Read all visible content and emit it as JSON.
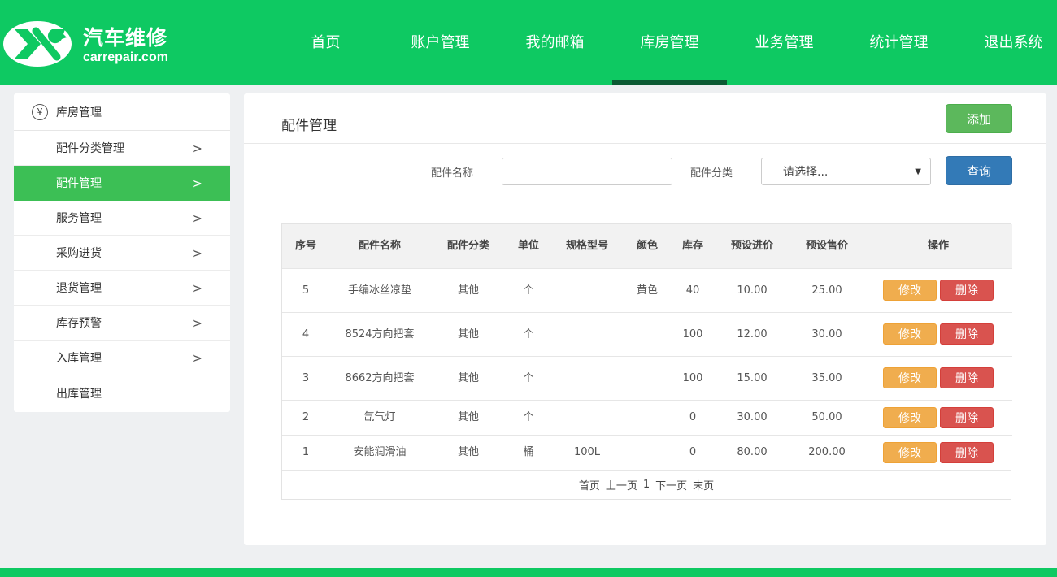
{
  "brand": {
    "title": "汽车维修",
    "subtitle": "carrepair.com"
  },
  "nav": [
    {
      "label": "首页",
      "active": false
    },
    {
      "label": "账户管理",
      "active": false
    },
    {
      "label": "我的邮箱",
      "active": false
    },
    {
      "label": "库房管理",
      "active": true
    },
    {
      "label": "业务管理",
      "active": false
    },
    {
      "label": "统计管理",
      "active": false
    },
    {
      "label": "退出系统",
      "active": false
    }
  ],
  "sidebar": {
    "header": "库房管理",
    "header_icon_glyph": "¥",
    "items": [
      {
        "label": "配件分类管理",
        "chevron": true,
        "active": false
      },
      {
        "label": "配件管理",
        "chevron": true,
        "active": true
      },
      {
        "label": "服务管理",
        "chevron": true,
        "active": false
      },
      {
        "label": "采购进货",
        "chevron": true,
        "active": false
      },
      {
        "label": "退货管理",
        "chevron": true,
        "active": false
      },
      {
        "label": "库存预警",
        "chevron": true,
        "active": false
      },
      {
        "label": "入库管理",
        "chevron": true,
        "active": false
      },
      {
        "label": "出库管理",
        "chevron": false,
        "active": false
      }
    ]
  },
  "panel": {
    "title": "配件管理",
    "add_label": "添加"
  },
  "search": {
    "name_label": "配件名称",
    "name_value": "",
    "category_label": "配件分类",
    "category_selected": "请选择...",
    "query_label": "查询"
  },
  "table": {
    "headers": [
      "序号",
      "配件名称",
      "配件分类",
      "单位",
      "规格型号",
      "颜色",
      "库存",
      "预设进价",
      "预设售价",
      "操作"
    ],
    "rows": [
      {
        "id": "5",
        "name": "手编冰丝凉垫",
        "category": "其他",
        "unit": "个",
        "spec": "",
        "color": "黄色",
        "stock": "40",
        "buy": "10.00",
        "sell": "25.00"
      },
      {
        "id": "4",
        "name": "8524方向把套",
        "category": "其他",
        "unit": "个",
        "spec": "",
        "color": "",
        "stock": "100",
        "buy": "12.00",
        "sell": "30.00"
      },
      {
        "id": "3",
        "name": "8662方向把套",
        "category": "其他",
        "unit": "个",
        "spec": "",
        "color": "",
        "stock": "100",
        "buy": "15.00",
        "sell": "35.00"
      },
      {
        "id": "2",
        "name": "氙气灯",
        "category": "其他",
        "unit": "个",
        "spec": "",
        "color": "",
        "stock": "0",
        "buy": "30.00",
        "sell": "50.00"
      },
      {
        "id": "1",
        "name": "安能润滑油",
        "category": "其他",
        "unit": "桶",
        "spec": "100L",
        "color": "",
        "stock": "0",
        "buy": "80.00",
        "sell": "200.00"
      }
    ],
    "edit_label": "修改",
    "delete_label": "删除"
  },
  "pager": {
    "first": "首页",
    "prev": "上一页",
    "current": "1",
    "next": "下一页",
    "last": "末页"
  },
  "colors": {
    "header_green": "#0ec962",
    "active_green": "#3cbf55",
    "add_green": "#5cb85c",
    "query_blue": "#337ab7",
    "edit_orange": "#f0ad4e",
    "delete_red": "#d9534f"
  }
}
